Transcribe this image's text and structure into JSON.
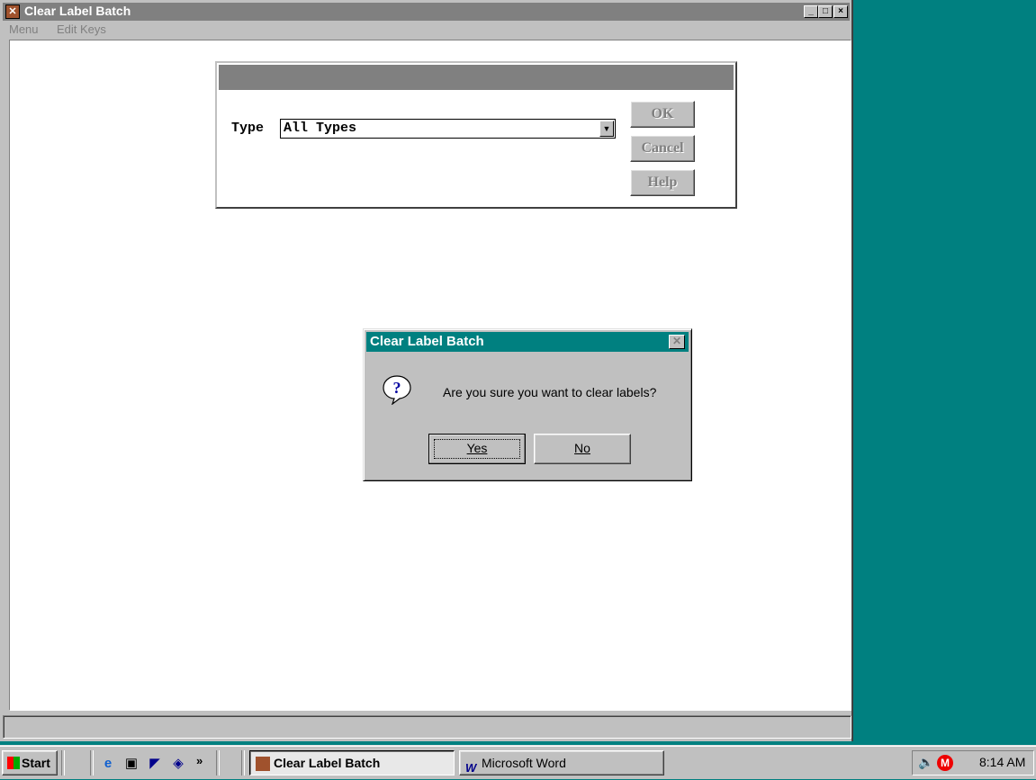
{
  "window": {
    "title": "Clear Label Batch",
    "controls": {
      "minimize": "_",
      "maximize": "□",
      "close": "×"
    }
  },
  "menu_bar": {
    "items": [
      {
        "label": "Menu"
      },
      {
        "label": "Edit Keys"
      }
    ]
  },
  "type_dialog": {
    "type_label": "Type",
    "type_value": "All Types",
    "buttons": {
      "ok": "OK",
      "cancel": "Cancel",
      "help": "Help"
    }
  },
  "confirm_dialog": {
    "title": "Clear Label Batch",
    "message": "Are you sure you want to clear labels?",
    "yes_label": "Yes",
    "no_label": "No",
    "icon": "question-icon"
  },
  "taskbar": {
    "start_label": "Start",
    "quick_launch": [
      "internet-explorer-icon",
      "desktop-icon",
      "arrow-tool-icon",
      "tag-tool-icon"
    ],
    "tasks": [
      {
        "label": "Clear Label Batch",
        "active": true
      },
      {
        "label": "Microsoft Word",
        "active": false
      }
    ],
    "clock": "8:14 AM"
  },
  "colors": {
    "desktop": "#008080",
    "inactive_title": "#808080",
    "active_title": "#008080",
    "face": "#c0c0c0"
  }
}
